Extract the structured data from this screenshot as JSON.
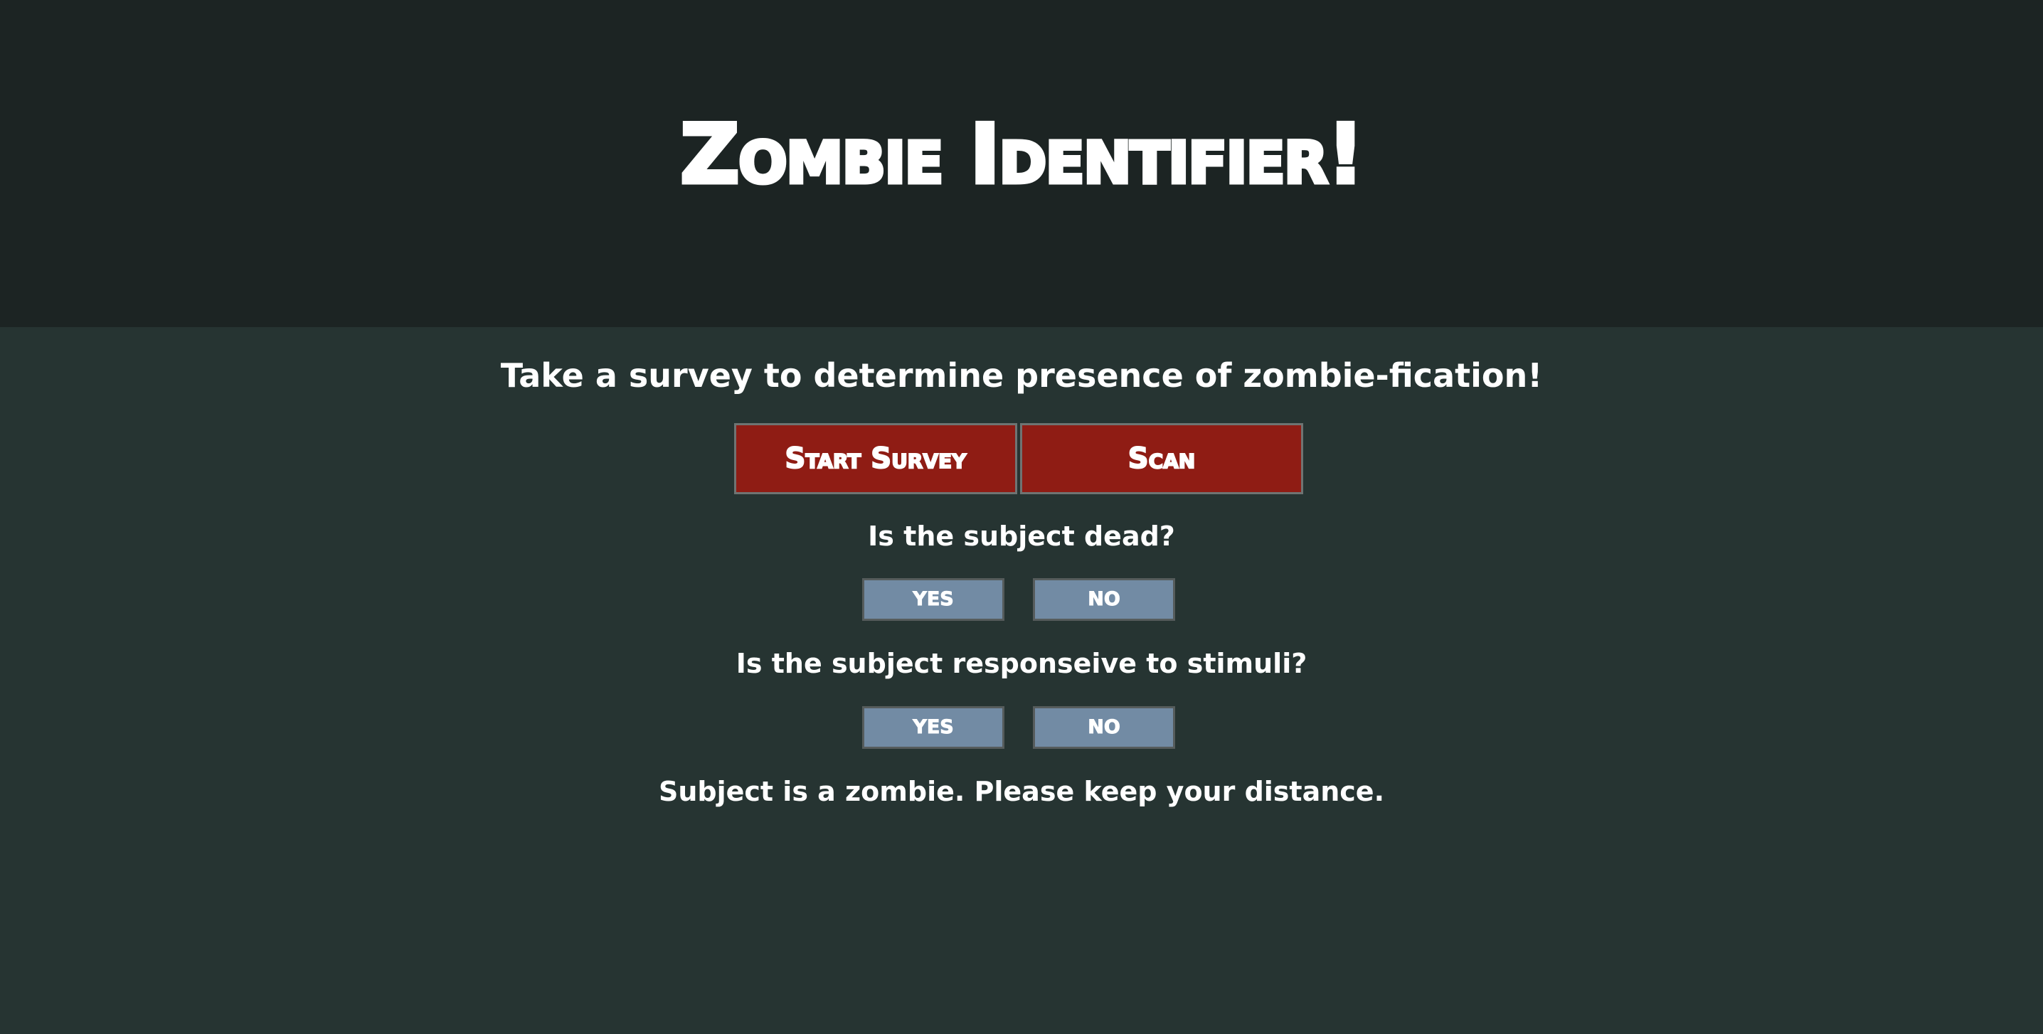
{
  "header": {
    "title": "Zombie Identifier!"
  },
  "intro": {
    "text": "Take a survey to determine presence of zombie-fication!"
  },
  "actions": {
    "start_survey": "Start Survey",
    "scan": "Scan"
  },
  "survey": {
    "questions": [
      {
        "text": "Is the subject dead?",
        "yes": "YES",
        "no": "NO"
      },
      {
        "text": "Is the subject responseive to stimuli?",
        "yes": "YES",
        "no": "NO"
      }
    ],
    "result": "Subject is a zombie. Please keep your distance."
  },
  "colors": {
    "header_background": "#1c2423",
    "page_background": "#263432",
    "primary_button": "#8f1c14",
    "answer_button": "#728ba4",
    "text": "#ffffff"
  }
}
